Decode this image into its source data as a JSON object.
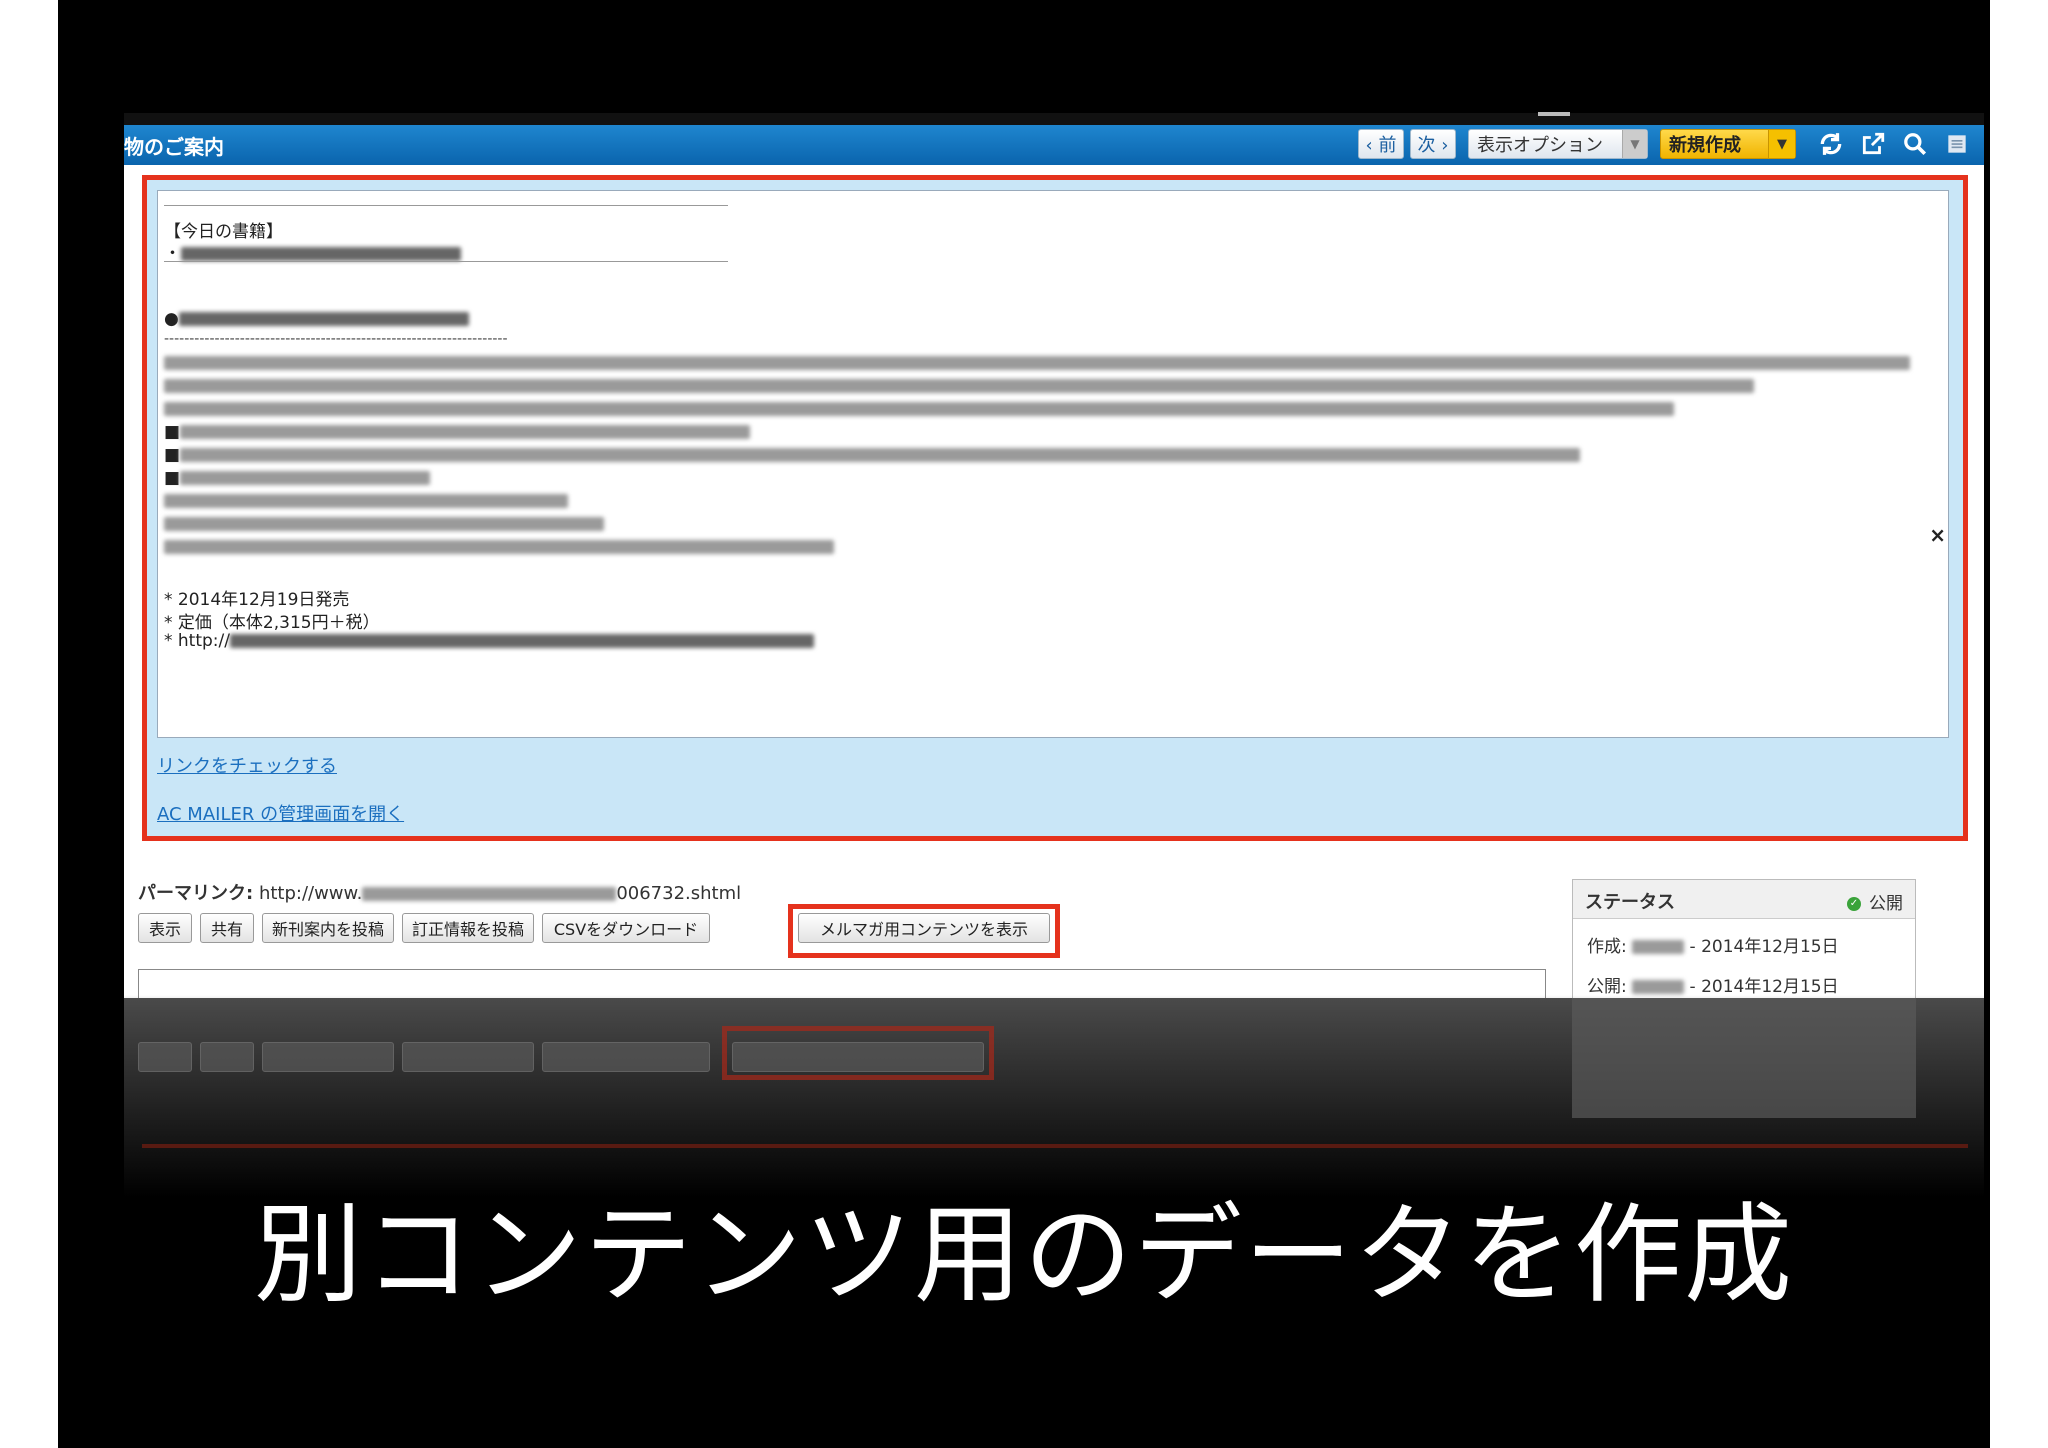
{
  "app": {
    "window_title": "物のご案内"
  },
  "toolbar": {
    "prev_label": "‹ 前",
    "next_label": "次 ›",
    "display_options_label": "表示オプション",
    "new_label": "新規作成",
    "icons": [
      "refresh-icon",
      "external-link-icon",
      "search-icon",
      "menu-icon"
    ]
  },
  "mail": {
    "header_line": "【今日の書籍】",
    "bullet_prefix": "・",
    "dash_rule": "--------------------------------------------------------------------",
    "square_bullet": "■",
    "bullet_mark": "●",
    "release": "* 2014年12月19日発売",
    "price": "* 定価（本体2,315円＋税）",
    "url_prefix": "* http://",
    "close_glyph": "×",
    "link_check": "リンクをチェックする",
    "link_admin": "AC MAILER の管理画面を開く"
  },
  "permalink": {
    "label": "パーマリンク:",
    "prefix": "http://www.",
    "suffix": "006732.shtml"
  },
  "actions": {
    "view": "表示",
    "share": "共有",
    "post_new": "新刊案内を投稿",
    "post_correction": "訂正情報を投稿",
    "download_csv": "CSVをダウンロード",
    "show_newsletter": "メルマガ用コンテンツを表示"
  },
  "status": {
    "title": "ステータス",
    "state": "公開",
    "created_label": "作成:",
    "created_date": "- 2014年12月15日",
    "published_label": "公開:",
    "published_date": "- 2014年12月15日"
  },
  "caption": "別コンテンツ用のデータを作成",
  "colors": {
    "topbar": "#0a64ad",
    "highlight": "#e5321d",
    "mail_bg": "#c9e6f7",
    "new_button": "#f0b400"
  }
}
